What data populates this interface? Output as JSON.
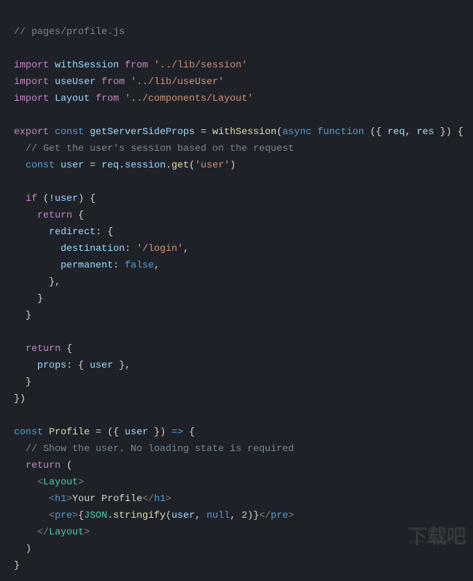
{
  "code": {
    "l1_comment": "// pages/profile.js",
    "l3_import": "import",
    "l3_ident": "withSession",
    "l3_from": "from",
    "l3_path": "'../lib/session'",
    "l4_import": "import",
    "l4_ident": "useUser",
    "l4_from": "from",
    "l4_path": "'../lib/useUser'",
    "l5_import": "import",
    "l5_ident": "Layout",
    "l5_from": "from",
    "l5_path": "'../components/Layout'",
    "l7_export": "export",
    "l7_const": "const",
    "l7_name": "getServerSideProps",
    "l7_eq": " = ",
    "l7_call": "withSession",
    "l7_open": "(",
    "l7_async": "async",
    "l7_function": "function",
    "l7_args": " ({ ",
    "l7_req": "req",
    "l7_comma": ", ",
    "l7_res": "res",
    "l7_close": " }) {",
    "l8_comment": "  // Get the user's session based on the request",
    "l9_const": "const",
    "l9_user": "user",
    "l9_eq": " = ",
    "l9_req": "req",
    "l9_dot1": ".",
    "l9_session": "session",
    "l9_dot2": ".",
    "l9_get": "get",
    "l9_open": "(",
    "l9_arg": "'user'",
    "l9_close": ")",
    "l11_if": "if",
    "l11_open": " (!",
    "l11_user": "user",
    "l11_close": ") {",
    "l12_return": "return",
    "l12_brace": " {",
    "l13_redirect": "redirect",
    "l13_colon": ": {",
    "l14_dest": "destination",
    "l14_colon": ": ",
    "l14_val": "'/login'",
    "l14_comma": ",",
    "l15_perm": "permanent",
    "l15_colon": ": ",
    "l15_val": "false",
    "l15_comma": ",",
    "l16_close": "      },",
    "l17_close": "    }",
    "l18_close": "  }",
    "l20_return": "return",
    "l20_brace": " {",
    "l21_props": "props",
    "l21_colon": ": { ",
    "l21_user": "user",
    "l21_close": " },",
    "l22_close": "  }",
    "l23_close": "})",
    "l25_const": "const",
    "l25_name": "Profile",
    "l25_eq": " = ({ ",
    "l25_user": "user",
    "l25_close": " }) ",
    "l25_arrow": "=>",
    "l25_brace": " {",
    "l26_comment": "  // Show the user. No loading state is required",
    "l27_return": "return",
    "l27_paren": " (",
    "l28_open": "<",
    "l28_tag": "Layout",
    "l28_close": ">",
    "l29_open": "<",
    "l29_tag": "h1",
    "l29_close1": ">",
    "l29_text": "Your Profile",
    "l29_open2": "</",
    "l29_tag2": "h1",
    "l29_close2": ">",
    "l30_open": "<",
    "l30_tag": "pre",
    "l30_close1": ">",
    "l30_bopen": "{",
    "l30_json": "JSON",
    "l30_dot": ".",
    "l30_stringify": "stringify",
    "l30_popen": "(",
    "l30_user": "user",
    "l30_c1": ", ",
    "l30_null": "null",
    "l30_c2": ", ",
    "l30_two": "2",
    "l30_pclose": ")",
    "l30_bclose": "}",
    "l30_open2": "</",
    "l30_tag2": "pre",
    "l30_close2": ">",
    "l31_open": "</",
    "l31_tag": "Layout",
    "l31_close": ">",
    "l32_paren": "  )",
    "l33_brace": "}"
  },
  "watermark": {
    "main": "下载吧",
    "url": "www.xiazaiba.com"
  }
}
